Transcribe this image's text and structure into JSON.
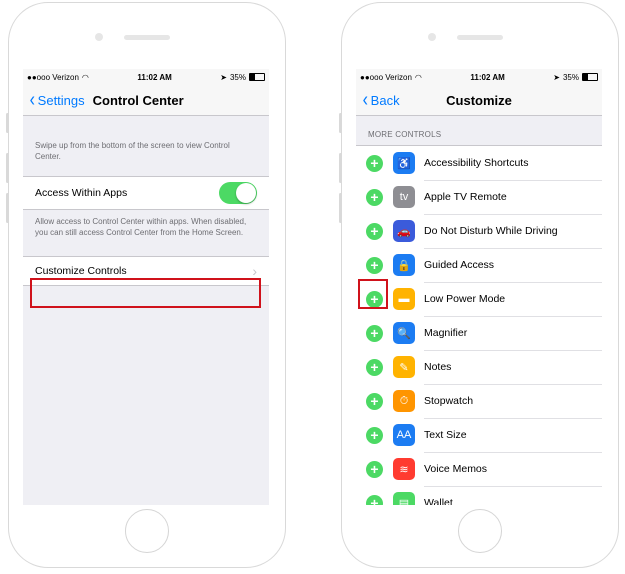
{
  "left": {
    "status": {
      "carrier": "●●ooo Verizon",
      "time": "11:02 AM",
      "battery": "35%"
    },
    "nav": {
      "back_label": "Settings",
      "title": "Control Center"
    },
    "intro_text": "Swipe up from the bottom of the screen to view Control Center.",
    "access_label": "Access Within Apps",
    "access_footnote": "Allow access to Control Center within apps. When disabled, you can still access Control Center from the Home Screen.",
    "customize_label": "Customize Controls"
  },
  "right": {
    "status": {
      "carrier": "●●ooo Verizon",
      "time": "11:02 AM",
      "battery": "35%"
    },
    "nav": {
      "back_label": "Back",
      "title": "Customize"
    },
    "section_header": "MORE CONTROLS",
    "items": [
      {
        "label": "Accessibility Shortcuts",
        "icon": "accessibility-icon",
        "color": "#1c7cf2",
        "glyph": "♿"
      },
      {
        "label": "Apple TV Remote",
        "icon": "apple-tv-icon",
        "color": "#8e8e93",
        "glyph": "tv"
      },
      {
        "label": "Do Not Disturb While Driving",
        "icon": "car-icon",
        "color": "#3b5bdb",
        "glyph": "🚗"
      },
      {
        "label": "Guided Access",
        "icon": "lock-icon",
        "color": "#1c7cf2",
        "glyph": "🔒"
      },
      {
        "label": "Low Power Mode",
        "icon": "battery-icon",
        "color": "#ffb300",
        "glyph": "▬"
      },
      {
        "label": "Magnifier",
        "icon": "magnifier-icon",
        "color": "#1c7cf2",
        "glyph": "🔍"
      },
      {
        "label": "Notes",
        "icon": "notes-icon",
        "color": "#ffb300",
        "glyph": "✎"
      },
      {
        "label": "Stopwatch",
        "icon": "stopwatch-icon",
        "color": "#ff9500",
        "glyph": "⏱"
      },
      {
        "label": "Text Size",
        "icon": "text-size-icon",
        "color": "#1c7cf2",
        "glyph": "AA"
      },
      {
        "label": "Voice Memos",
        "icon": "voice-memos-icon",
        "color": "#ff3b30",
        "glyph": "≋"
      },
      {
        "label": "Wallet",
        "icon": "wallet-icon",
        "color": "#4cd964",
        "glyph": "▤"
      }
    ]
  },
  "colors": {
    "accent": "#007aff",
    "toggle_on": "#4cd964",
    "highlight": "#d0121b"
  }
}
